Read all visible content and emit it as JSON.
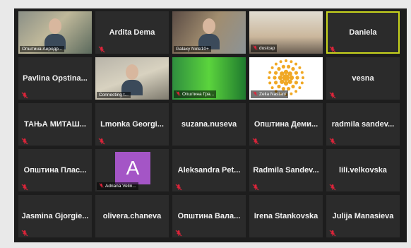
{
  "tiles": [
    {
      "name": "",
      "label": "Општина Аеродр...",
      "video": "vid1",
      "muted": false
    },
    {
      "name": "Ardita Dema",
      "label": "",
      "video": "",
      "muted": true
    },
    {
      "name": "",
      "label": "Galaxy Note10+",
      "video": "vid3",
      "muted": false
    },
    {
      "name": "",
      "label": "dusicap",
      "video": "vid4",
      "muted": true
    },
    {
      "name": "Daniela",
      "label": "",
      "video": "",
      "muted": true,
      "active": true
    },
    {
      "name": "Pavlina Opstina...",
      "label": "",
      "video": "",
      "muted": true
    },
    {
      "name": "",
      "label": "Connecting t...",
      "video": "vid2",
      "muted": false
    },
    {
      "name": "",
      "label": "Општина Гра...",
      "video": "vid5",
      "muted": true
    },
    {
      "name": "",
      "label": "Zelia Nastani",
      "video": "vid6",
      "muted": true
    },
    {
      "name": "vesna",
      "label": "",
      "video": "",
      "muted": true
    },
    {
      "name": "ТАЊА МИТАШ...",
      "label": "",
      "video": "",
      "muted": true
    },
    {
      "name": "Lmonka Georgi...",
      "label": "",
      "video": "",
      "muted": true
    },
    {
      "name": "suzana.nuseva",
      "label": "",
      "video": "",
      "muted": false
    },
    {
      "name": "Општина Деми...",
      "label": "",
      "video": "",
      "muted": true
    },
    {
      "name": "radmila sandev...",
      "label": "",
      "video": "",
      "muted": true
    },
    {
      "name": "Општина Плас...",
      "label": "",
      "video": "",
      "muted": true
    },
    {
      "name": "",
      "label": "Adriana Velin...",
      "video": "",
      "muted": true,
      "avatar": "A",
      "avatar_color": "#a455c6"
    },
    {
      "name": "Aleksandra Pet...",
      "label": "",
      "video": "",
      "muted": true
    },
    {
      "name": "Radmila Sandev...",
      "label": "",
      "video": "",
      "muted": true
    },
    {
      "name": "lili.velkovska",
      "label": "",
      "video": "",
      "muted": true
    },
    {
      "name": "Jasmina Gjorgie...",
      "label": "",
      "video": "",
      "muted": true
    },
    {
      "name": "olivera.chaneva",
      "label": "",
      "video": "",
      "muted": false
    },
    {
      "name": "Општина Вала...",
      "label": "",
      "video": "",
      "muted": true
    },
    {
      "name": "Irena Stankovska",
      "label": "",
      "video": "",
      "muted": false
    },
    {
      "name": "Julija Manasieva",
      "label": "",
      "video": "",
      "muted": true
    }
  ],
  "colors": {
    "mute_icon": "#e0243a",
    "active_border": "#c9d51d",
    "tile_bg": "#2b2b2b"
  },
  "icons": {
    "mute": "muted-microphone-icon"
  }
}
